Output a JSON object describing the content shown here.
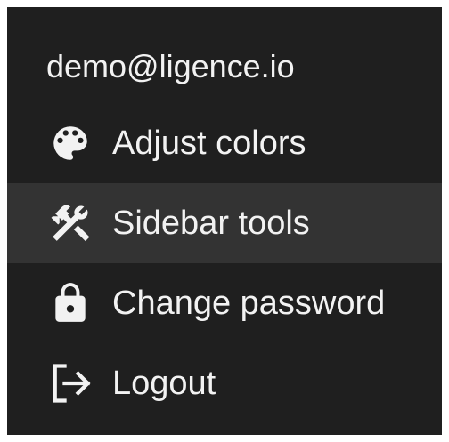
{
  "user": {
    "email": "demo@ligence.io"
  },
  "menu": {
    "items": [
      {
        "label": "Adjust colors",
        "icon": "palette-icon",
        "active": false
      },
      {
        "label": "Sidebar tools",
        "icon": "tools-icon",
        "active": true
      },
      {
        "label": "Change password",
        "icon": "lock-icon",
        "active": false
      },
      {
        "label": "Logout",
        "icon": "logout-icon",
        "active": false
      }
    ]
  },
  "colors": {
    "background": "#1f1f1f",
    "active_background": "#333333",
    "text": "#f2f2f2"
  }
}
